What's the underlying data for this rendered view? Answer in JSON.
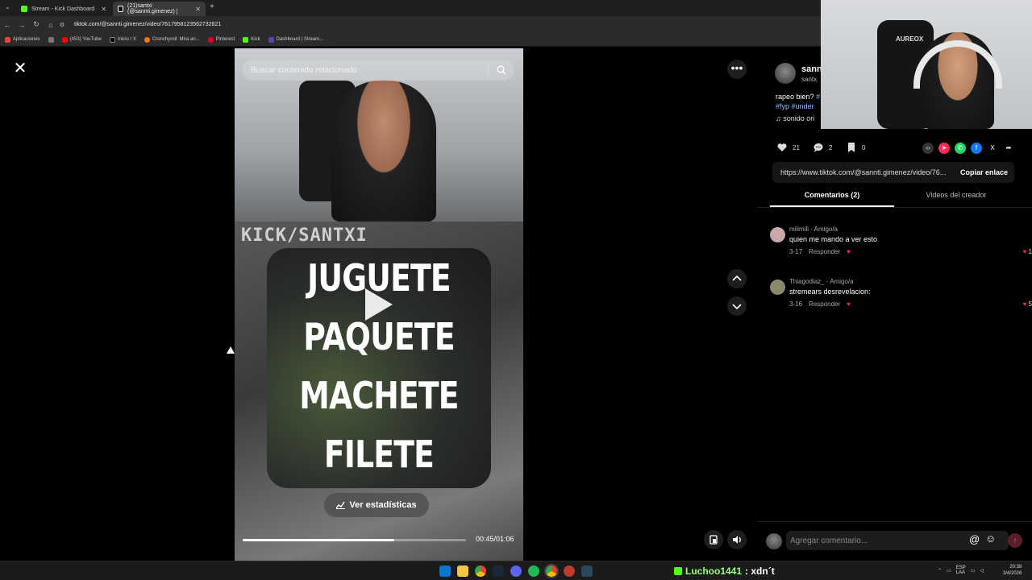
{
  "browser": {
    "tabs": [
      {
        "label": "Stream - Kick Dashboard",
        "favicon_color": "#53fc18",
        "active": false
      },
      {
        "label": "(21)santxi (@sannti.gimenez) |",
        "favicon_color": "#111111",
        "active": true
      }
    ],
    "url": "tiktok.com/@sannti.gimenez/video/7617958123562732821",
    "bookmarks": [
      {
        "label": "Aplicaciones",
        "color": "#ea4335"
      },
      {
        "label": "(453) YouTube",
        "color": "#ff0000"
      },
      {
        "label": "Inicio / X",
        "color": "#000000"
      },
      {
        "label": "Crunchyroll: Mira an...",
        "color": "#f47521"
      },
      {
        "label": "Pinterest",
        "color": "#e60023"
      },
      {
        "label": "Kick",
        "color": "#53fc18"
      },
      {
        "label": "Dashboard | Stream...",
        "color": "#6441a5"
      }
    ]
  },
  "video": {
    "search_placeholder": "Buscar contenido relacionado",
    "overlay_label": "KICK/SANTXI",
    "meme_lines": [
      "JUGUETE",
      "PAQUETE",
      "MACHETE",
      "FILETE"
    ],
    "stats_button": "Ver estadísticas",
    "time": "00:45/01:06",
    "progress": 0.68
  },
  "author": {
    "name": "sann",
    "handle": "santx",
    "description_text": "rapeo bien?",
    "description_tags_1": "#",
    "description_tags_2": "#fyp #under",
    "sound": "sonido ori",
    "webcam_brand": "AUREOX"
  },
  "actions": {
    "likes": "21",
    "comments": "2",
    "saves": "0"
  },
  "share": {
    "link": "https://www.tiktok.com/@sannti.gimenez/video/76...",
    "copy_label": "Copiar enlace"
  },
  "tabs": {
    "comments": "Comentarios (2)",
    "creator": "Videos del creador"
  },
  "comments": [
    {
      "user": "milimili · Amigo/a",
      "text": "quien me mando a ver esto",
      "date": "3-17",
      "reply": "Responder",
      "likes": "1",
      "avatar_color": "#c9a9a9"
    },
    {
      "user": "Thiagodiaz_ · Amigo/a",
      "text": "stremears desrevelacion:",
      "date": "3-16",
      "reply": "Responder",
      "likes": "5",
      "avatar_color": "#8a8a6a"
    }
  ],
  "comment_input": {
    "placeholder": "Agregar comentario..."
  },
  "taskbar": {
    "chat_user": "Luchoo1441",
    "chat_text": ": xdn´t",
    "lang": "ESP\nLAA",
    "time": "20:38",
    "date": "3/4/2026"
  },
  "colors": {
    "accent": "#fe2c55",
    "link": "#8fb8ff",
    "kick_green": "#53fc18"
  }
}
